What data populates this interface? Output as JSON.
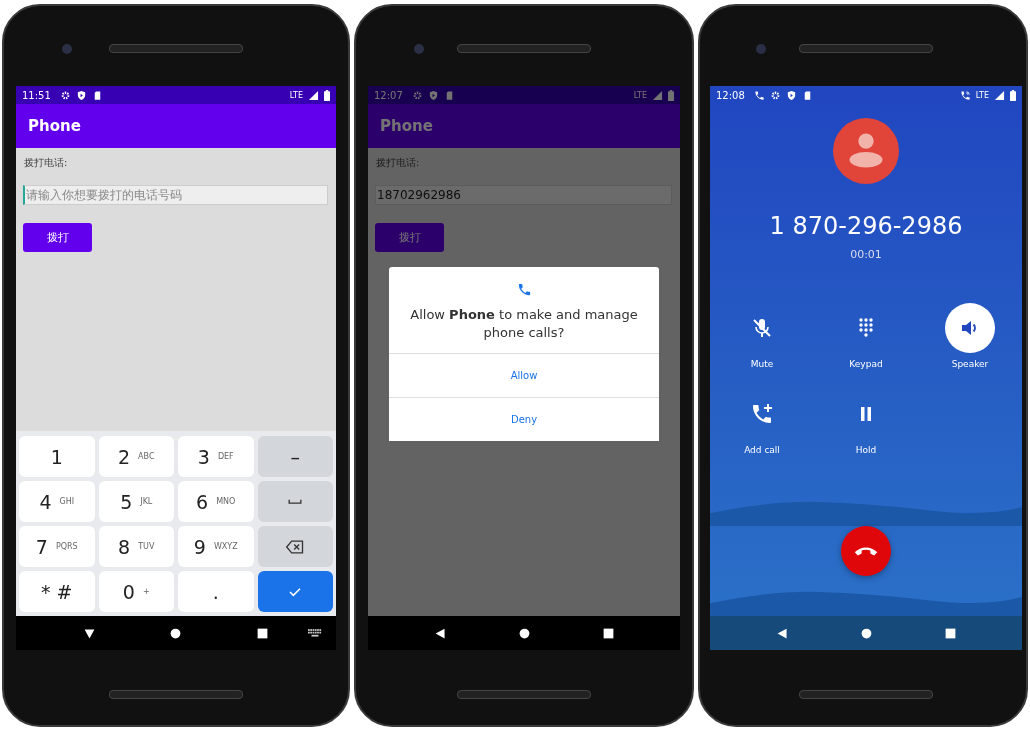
{
  "phones": [
    {
      "kind": "form",
      "status_bar": {
        "time": "11:51",
        "network": "LTE"
      },
      "app_bar": {
        "title": "Phone"
      },
      "label": "拨打电话:",
      "field": {
        "placeholder": "请输入你想要拨打的电话号码"
      },
      "button": "拨打",
      "keyboard": {
        "keys": [
          {
            "kind": "digit",
            "main": "1"
          },
          {
            "kind": "digit",
            "main": "2",
            "sub": "ABC"
          },
          {
            "kind": "digit",
            "main": "3",
            "sub": "DEF"
          },
          {
            "kind": "symbol",
            "main": "–"
          },
          {
            "kind": "digit",
            "main": "4",
            "sub": "GHI"
          },
          {
            "kind": "digit",
            "main": "5",
            "sub": "JKL"
          },
          {
            "kind": "digit",
            "main": "6",
            "sub": "MNO"
          },
          {
            "kind": "space"
          },
          {
            "kind": "digit",
            "main": "7",
            "sub": "PQRS"
          },
          {
            "kind": "digit",
            "main": "8",
            "sub": "TUV"
          },
          {
            "kind": "digit",
            "main": "9",
            "sub": "WXYZ"
          },
          {
            "kind": "backspace"
          },
          {
            "kind": "digit",
            "main": "* #"
          },
          {
            "kind": "digit",
            "main": "0",
            "sub": "+"
          },
          {
            "kind": "digit",
            "main": "."
          },
          {
            "kind": "done"
          }
        ]
      },
      "nav": {
        "kind": "ime"
      }
    },
    {
      "kind": "form",
      "status_bar": {
        "time": "12:07",
        "network": "LTE"
      },
      "app_bar": {
        "title": "Phone"
      },
      "label": "拨打电话:",
      "field": {
        "value": "18702962986"
      },
      "button": "拨打",
      "dialog": {
        "message": "Allow **Phone** to make and manage phone calls?",
        "buttons": [
          "Allow",
          "Deny"
        ]
      },
      "nav": {
        "kind": "standard"
      }
    },
    {
      "kind": "call",
      "status_bar": {
        "time": "12:08",
        "network": "LTE"
      },
      "number": "1 870-296-2986",
      "timer": "00:01",
      "controls": [
        {
          "kind": "mute",
          "label": "Mute",
          "on": false
        },
        {
          "kind": "keypad",
          "label": "Keypad",
          "on": false
        },
        {
          "kind": "speaker",
          "label": "Speaker",
          "on": true
        },
        {
          "kind": "add",
          "label": "Add call",
          "on": false
        },
        {
          "kind": "hold",
          "label": "Hold",
          "on": false
        }
      ],
      "nav": {
        "kind": "standard"
      }
    }
  ]
}
